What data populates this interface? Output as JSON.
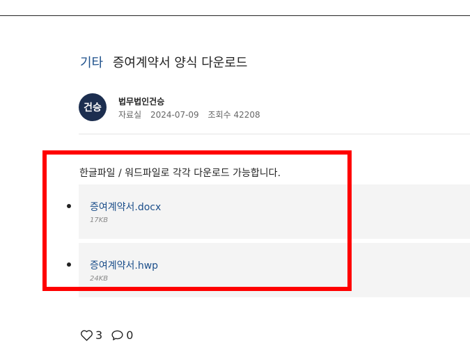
{
  "post": {
    "category": "기타",
    "title": "증여계약서 양식 다운로드"
  },
  "author": {
    "avatar_text": "건승",
    "name": "법무법인건승",
    "board": "자료실",
    "date": "2024-07-09",
    "views": "조회수 42208"
  },
  "content": {
    "intro": "한글파일 / 워드파일로 각각 다운로드 가능합니다.",
    "files": [
      {
        "name": "증여계약서.docx",
        "size": "17KB"
      },
      {
        "name": "증여계약서.hwp",
        "size": "24KB"
      }
    ]
  },
  "reactions": {
    "likes": "3",
    "comments": "0"
  },
  "colors": {
    "accent": "#1b4e8a",
    "highlight": "#ff0000",
    "avatar_bg": "#1c2e4f"
  },
  "icons": [
    "heart-icon",
    "comment-icon"
  ]
}
